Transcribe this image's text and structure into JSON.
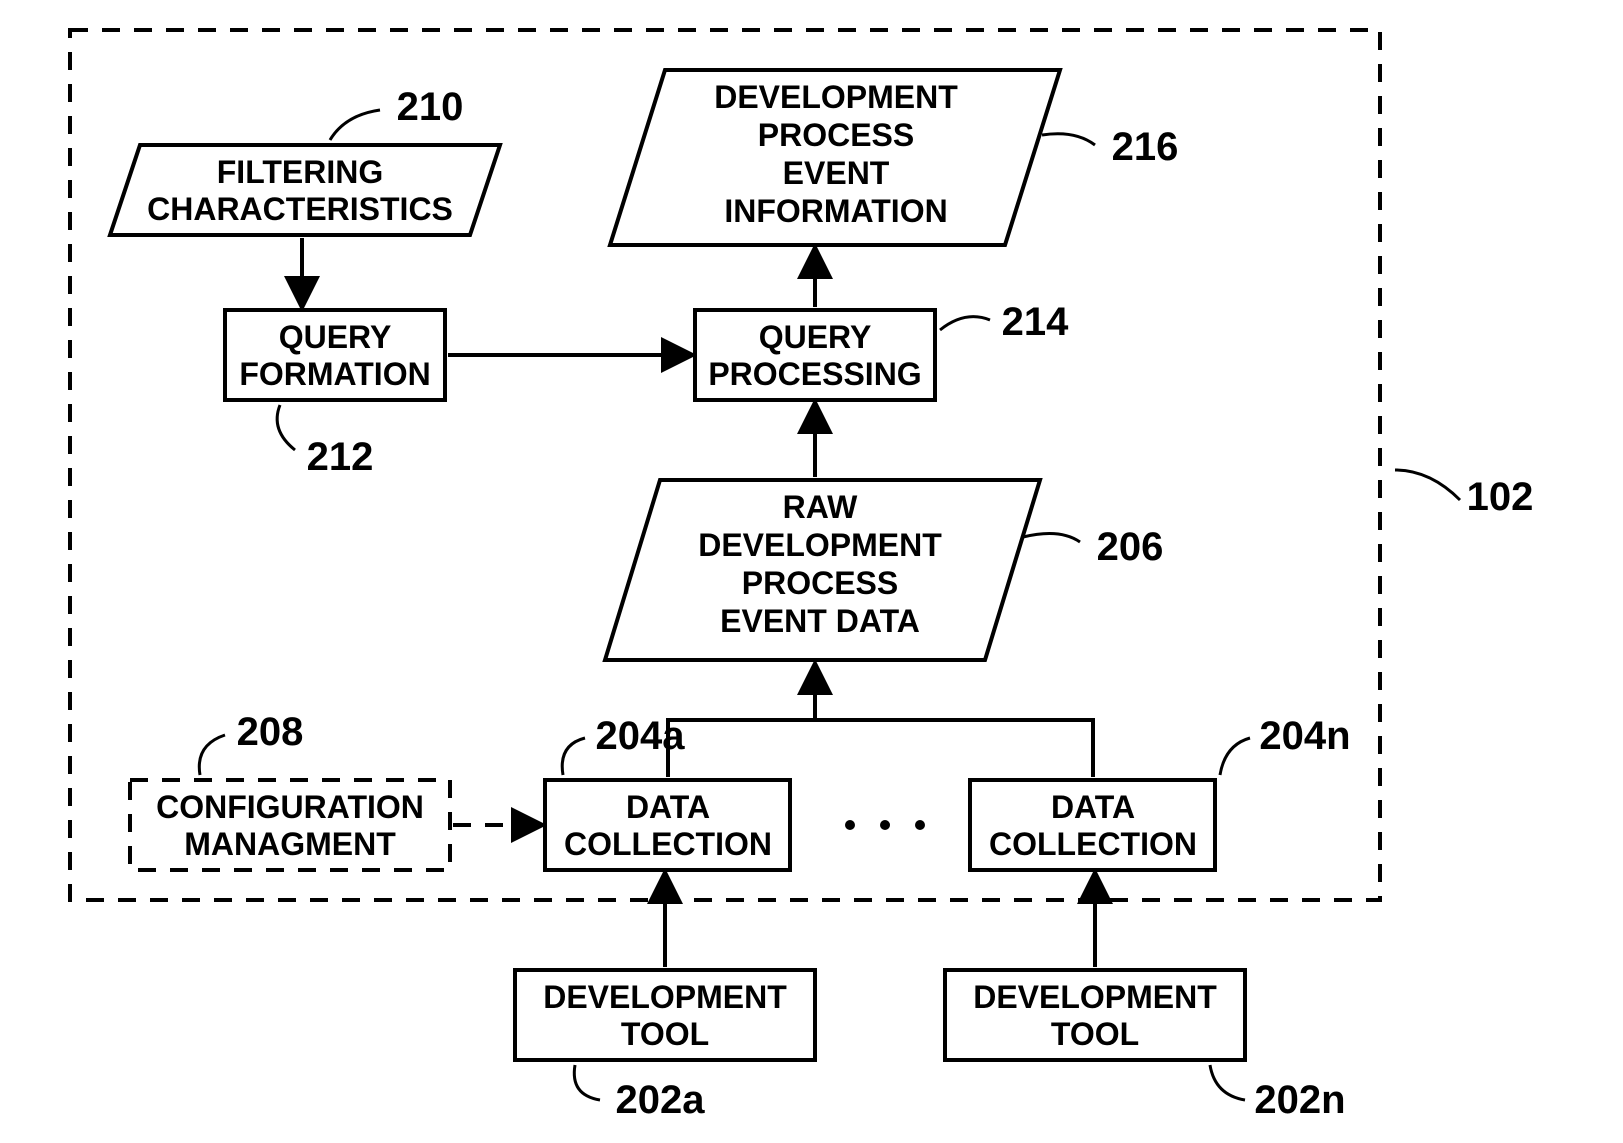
{
  "chart_data": {
    "type": "diagram",
    "title": "Development process event information flowchart"
  },
  "boundary": {
    "ref": "102"
  },
  "nodes": {
    "filtering": {
      "l1": "FILTERING",
      "l2": "CHARACTERISTICS",
      "ref": "210"
    },
    "queryFormation": {
      "l1": "QUERY",
      "l2": "FORMATION",
      "ref": "212"
    },
    "queryProcessing": {
      "l1": "QUERY",
      "l2": "PROCESSING",
      "ref": "214"
    },
    "devInfo": {
      "l1": "DEVELOPMENT",
      "l2": "PROCESS",
      "l3": "EVENT",
      "l4": "INFORMATION",
      "ref": "216"
    },
    "rawData": {
      "l1": "RAW",
      "l2": "DEVELOPMENT",
      "l3": "PROCESS",
      "l4": "EVENT DATA",
      "ref": "206"
    },
    "config": {
      "l1": "CONFIGURATION",
      "l2": "MANAGMENT",
      "ref": "208"
    },
    "dataCollA": {
      "l1": "DATA",
      "l2": "COLLECTION",
      "ref": "204a"
    },
    "dataCollN": {
      "l1": "DATA",
      "l2": "COLLECTION",
      "ref": "204n"
    },
    "devToolA": {
      "l1": "DEVELOPMENT",
      "l2": "TOOL",
      "ref": "202a"
    },
    "devToolN": {
      "l1": "DEVELOPMENT",
      "l2": "TOOL",
      "ref": "202n"
    }
  }
}
